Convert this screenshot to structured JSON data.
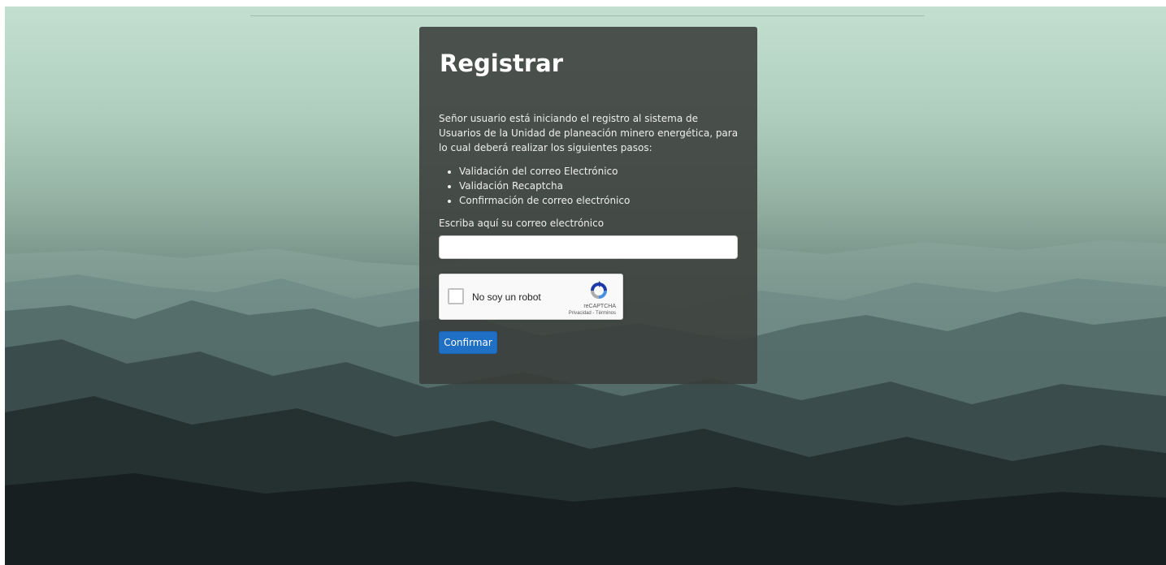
{
  "form": {
    "title": "Registrar",
    "intro": "Señor usuario está iniciando el registro al sistema de Usuarios de la Unidad de planeación minero energética, para lo cual deberá realizar los siguientes pasos:",
    "steps": [
      "Validación del correo Electrónico",
      "Validación Recaptcha",
      "Confirmación de correo electrónico"
    ],
    "email_label": "Escriba aquí su correo electrónico",
    "email_value": "",
    "confirm_label": "Confirmar"
  },
  "recaptcha": {
    "label": "No soy un robot",
    "brand": "reCAPTCHA",
    "privacy": "Privacidad",
    "separator": " - ",
    "terms": "Términos",
    "icon": "recaptcha-logo-icon"
  },
  "colors": {
    "button": "#1f6fc5",
    "card": "#3a3e3a",
    "sky": "#b8d8c6",
    "ground": "#161d1e"
  }
}
